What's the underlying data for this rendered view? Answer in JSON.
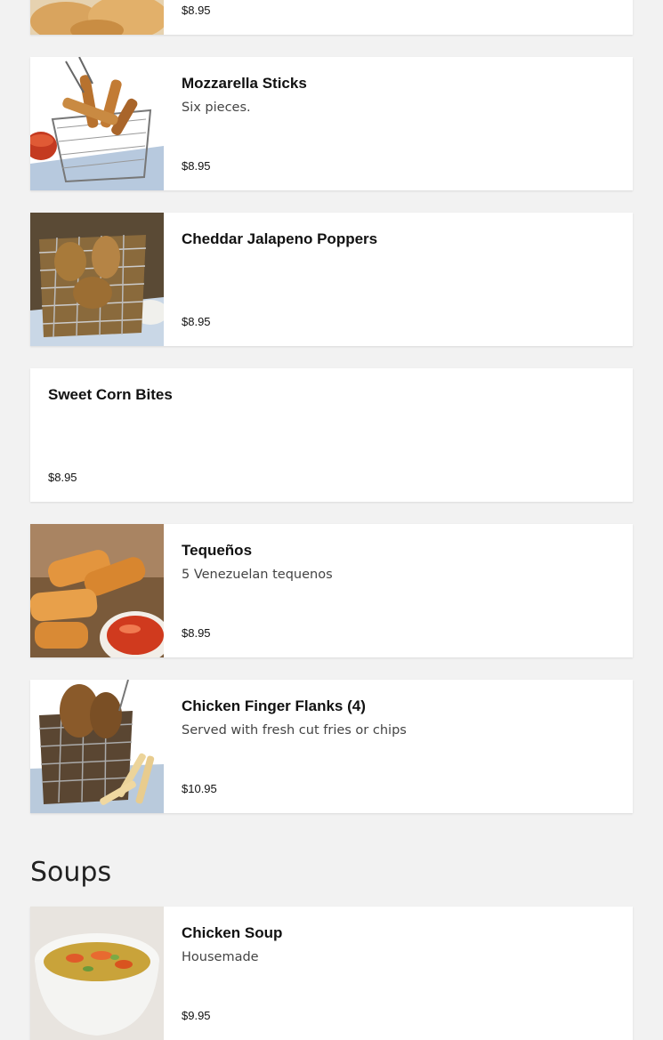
{
  "menu": {
    "items": [
      {
        "name": "",
        "description": "",
        "price": "$8.95",
        "image": "fried-appetizer-photo"
      },
      {
        "name": "Mozzarella Sticks",
        "description": "Six pieces.",
        "price": "$8.95",
        "image": "mozzarella-sticks-photo"
      },
      {
        "name": "Cheddar Jalapeno Poppers",
        "description": "",
        "price": "$8.95",
        "image": "jalapeno-poppers-photo"
      },
      {
        "name": "Sweet Corn Bites",
        "description": "",
        "price": "$8.95",
        "image": ""
      },
      {
        "name": "Tequeños",
        "description": "5 Venezuelan tequenos",
        "price": "$8.95",
        "image": "tequenos-photo"
      },
      {
        "name": "Chicken Finger Flanks (4)",
        "description": "Served with fresh cut fries or chips",
        "price": "$10.95",
        "image": "chicken-fingers-photo"
      }
    ]
  },
  "soups": {
    "title": "Soups",
    "items": [
      {
        "name": "Chicken Soup",
        "description": "Housemade",
        "price": "$9.95",
        "image": "chicken-soup-photo"
      }
    ]
  },
  "colors": {
    "page_background": "#f2f2f2",
    "card_background": "#ffffff",
    "text_primary": "#111111",
    "text_secondary": "#444444"
  }
}
